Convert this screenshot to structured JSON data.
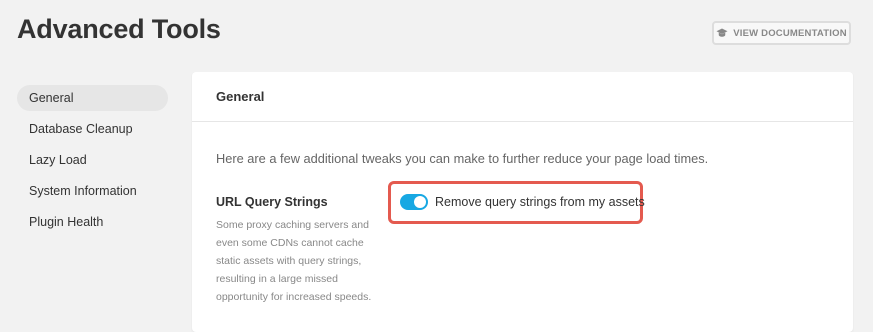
{
  "header": {
    "title": "Advanced Tools",
    "doc_button": {
      "label": "VIEW DOCUMENTATION",
      "icon": "graduation-cap-icon"
    }
  },
  "sidebar": {
    "items": [
      {
        "label": "General",
        "active": true
      },
      {
        "label": "Database Cleanup",
        "active": false
      },
      {
        "label": "Lazy Load",
        "active": false
      },
      {
        "label": "System Information",
        "active": false
      },
      {
        "label": "Plugin Health",
        "active": false
      }
    ]
  },
  "panel": {
    "title": "General",
    "intro": "Here are a few additional tweaks you can make to further reduce your page load times.",
    "option": {
      "title": "URL Query Strings",
      "description": "Some proxy caching servers and even some CDNs cannot cache static assets with query strings, resulting in a large missed opportunity for increased speeds.",
      "toggle_label": "Remove query strings from my assets",
      "toggle_on": true
    }
  },
  "colors": {
    "toggle_on": "#17a8e3",
    "highlight_border": "#e45a4f",
    "background": "#f2f2f2"
  }
}
